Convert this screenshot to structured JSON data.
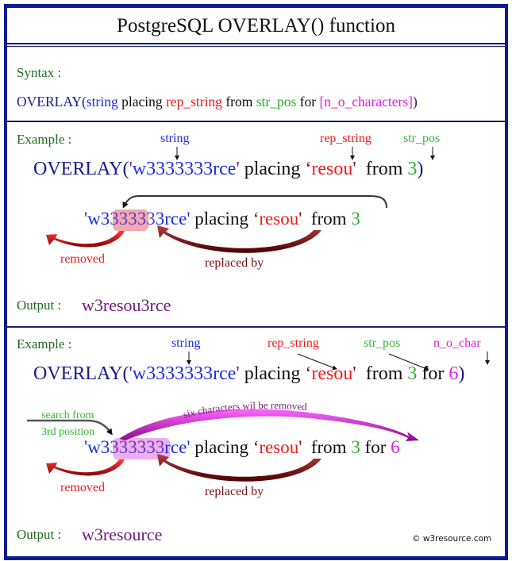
{
  "title": "PostgreSQL OVERLAY() function",
  "syntax": {
    "label": "Syntax :",
    "parts": {
      "fn": "OVERLAY(",
      "string": "string",
      "placing": " placing ",
      "rep_string": "rep_string",
      "from": " from ",
      "str_pos": "str_pos",
      "for": " for ",
      "n_o_characters": "[n_o_characters]",
      "close": ")"
    }
  },
  "example1": {
    "label": "Example :",
    "annotations": {
      "string": "string",
      "rep_string": "rep_string",
      "str_pos": "str_pos"
    },
    "statement": {
      "fn": "OVERLAY(",
      "open_quote": "'",
      "string_value": "w3333333rce",
      "close_quote": "'",
      "placing": " placing ",
      "rep_open": "‘",
      "rep_value": "resou",
      "rep_close": "'",
      "from": "  from ",
      "pos": "3",
      "close": ")"
    },
    "breakdown": {
      "prefix": "'w3",
      "removed_chars": "33333",
      "suffix": "3rce'",
      "placing": " placing ",
      "rep_open": "‘",
      "rep_value": "resou",
      "rep_close": "'",
      "from": "  from ",
      "pos": "3"
    },
    "removed_label": "removed",
    "replaced_label": "replaced by",
    "output_label": "Output :",
    "output_value": "w3resou3rce"
  },
  "example2": {
    "label": "Example :",
    "annotations": {
      "string": "string",
      "rep_string": "rep_string",
      "str_pos": "str_pos",
      "n_o_char": "n_o_char"
    },
    "statement": {
      "fn": "OVERLAY(",
      "open_quote": "'",
      "string_value": "w3333333rce",
      "close_quote": "'",
      "placing": " placing ",
      "rep_open": "‘",
      "rep_value": "resou",
      "rep_close": "'",
      "from": "  from ",
      "pos": "3",
      "for": " for ",
      "count": "6",
      "close": ")"
    },
    "breakdown": {
      "prefix": "'w3",
      "removed_chars": "333333",
      "suffix": "rce'",
      "placing": " placing ",
      "rep_open": "‘",
      "rep_value": "resou",
      "rep_close": "'",
      "from": "  from ",
      "pos": "3",
      "for": " for ",
      "count": "6"
    },
    "search_label_1": "search from",
    "search_label_2": "3rd position",
    "six_chars_label": "six characters wil be removed",
    "removed_label": "removed",
    "replaced_label": "replaced by",
    "output_label": "Output :",
    "output_value": "w3resource"
  },
  "copyright": "© w3resource.com",
  "colors": {
    "frame": "#0b1c8f",
    "string": "#1a2ee0",
    "rep_string": "#ee1c1c",
    "str_pos": "#2fae2f",
    "n_o_char": "#e01ee0",
    "label": "#1f6b1f",
    "output": "#6b1a78"
  }
}
